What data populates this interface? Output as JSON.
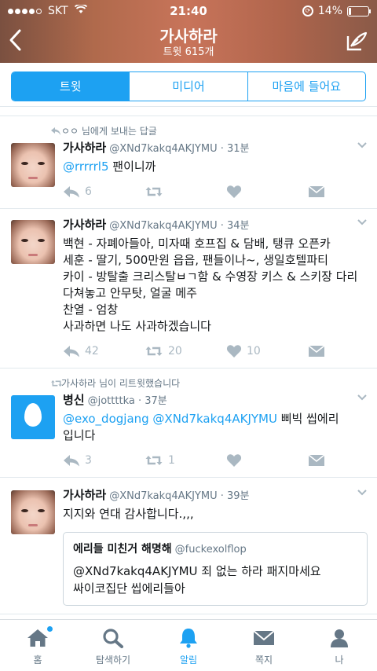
{
  "status_bar": {
    "carrier": "SKT",
    "time": "21:40",
    "battery": "14%",
    "battery_level": 0.14
  },
  "header": {
    "title": "가사하라",
    "subtitle": "트윗 615개"
  },
  "segments": [
    {
      "label": "트윗",
      "active": true
    },
    {
      "label": "미디어",
      "active": false
    },
    {
      "label": "마음에 들어요",
      "active": false
    }
  ],
  "tweets": [
    {
      "context": "ㅇㅇ 님에게 보내는 답글",
      "name": "가사하라",
      "handle": "@XNd7kakq4AKJYMU · 31분",
      "mention": "@rrrrrl5",
      "text": " 팬이니까",
      "reply_count": "6",
      "retweet_count": "",
      "like_count": ""
    },
    {
      "name": "가사하라",
      "handle": "@XNd7kakq4AKJYMU · 34분",
      "text": "백현 - 자폐아들아, 미자때 호프집 & 담배, 탱큐 오픈카\n세훈 - 딸기, 500만원 읍읍, 팬들이나~, 생일호텔파티\n카이 - 방탈출 크리스탈ㅂㄱ함 & 수영장 키스 & 스키장 다리다쳐놓고 안무탓, 얼굴 메주\n찬열 - 엄창\n사과하면 나도 사과하겠습니다",
      "reply_count": "42",
      "retweet_count": "20",
      "like_count": "10"
    },
    {
      "context": "가사하라 님이 리트윗했습니다",
      "name": "병신",
      "handle": "@jottttka · 37분",
      "mention": "@exo_dogjang @XNd7kakq4AKJYMU",
      "text": " 삐빅 씹에리\n입니다",
      "reply_count": "3",
      "retweet_count": "1",
      "like_count": ""
    },
    {
      "name": "가사하라",
      "handle": "@XNd7kakq4AKJYMU · 39분",
      "text": "지지와 연대 감사합니다.,,,",
      "quote": {
        "name": "에리들 미친거 해명해",
        "handle": "@fuckexolflop",
        "text": "@XNd7kakq4AKJYMU 죄 없는 하라 패지마세요\n싸이코집단 씹에리들아"
      }
    }
  ],
  "tabbar": [
    {
      "label": "홈",
      "icon": "home-icon"
    },
    {
      "label": "탐색하기",
      "icon": "search-icon"
    },
    {
      "label": "알림",
      "icon": "bell-icon",
      "active": true
    },
    {
      "label": "쪽지",
      "icon": "mail-icon"
    },
    {
      "label": "나",
      "icon": "person-icon"
    }
  ],
  "colors": {
    "accent": "#1da1f2",
    "muted": "#aab8c2"
  }
}
